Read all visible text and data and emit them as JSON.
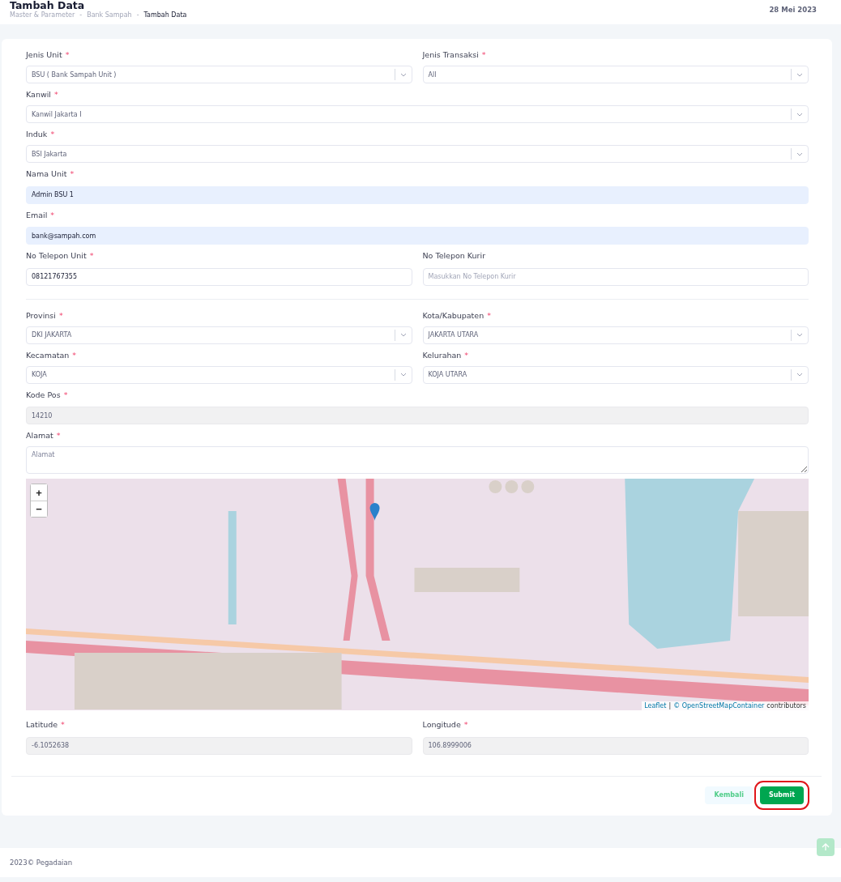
{
  "header": {
    "title": "Tambah Data",
    "breadcrumb": [
      {
        "label": "Master & Parameter",
        "current": false
      },
      {
        "label": "Bank Sampah",
        "current": false
      },
      {
        "label": "Tambah Data",
        "current": true
      }
    ],
    "separator": "-",
    "date": "28 Mei 2023"
  },
  "rows": [
    {
      "fields": [
        {
          "kind": "select",
          "label": "Jenis Unit",
          "required_mark": "*",
          "value": "BSU ( Bank Sampah Unit )"
        },
        {
          "kind": "select",
          "label": "Jenis Transaksi",
          "required_mark": "*",
          "value": "All"
        }
      ]
    },
    {
      "fields": [
        {
          "kind": "select",
          "label": "Kanwil",
          "required_mark": "*",
          "value": "Kanwil Jakarta I"
        }
      ]
    },
    {
      "fields": [
        {
          "kind": "select",
          "label": "Induk",
          "required_mark": "*",
          "value": "BSI Jakarta"
        }
      ]
    },
    {
      "fields": [
        {
          "kind": "text",
          "label": "Nama Unit",
          "required_mark": "*",
          "value": "Admin BSU 1",
          "autofilled": true,
          "disabled": false
        }
      ]
    },
    {
      "fields": [
        {
          "kind": "text",
          "label": "Email",
          "required_mark": "*",
          "value": "bank@sampah.com",
          "autofilled": true,
          "disabled": false
        }
      ]
    },
    {
      "fields": [
        {
          "kind": "text",
          "label": "No Telepon Unit",
          "required_mark": "*",
          "value": "08121767355",
          "autofilled": false,
          "disabled": false
        },
        {
          "kind": "text",
          "label": "No Telepon Kurir",
          "placeholder": "Masukkan No Telepon Kurir",
          "autofilled": false,
          "disabled": false
        }
      ]
    },
    {
      "divider": true,
      "fields": [
        {
          "kind": "select",
          "label": "Provinsi",
          "required_mark": "*",
          "value": "DKI JAKARTA"
        },
        {
          "kind": "select",
          "label": "Kota/Kabupaten",
          "required_mark": "*",
          "value": "JAKARTA UTARA"
        }
      ]
    },
    {
      "fields": [
        {
          "kind": "select",
          "label": "Kecamatan",
          "required_mark": "*",
          "value": "KOJA"
        },
        {
          "kind": "select",
          "label": "Kelurahan",
          "required_mark": "*",
          "value": "KOJA UTARA"
        }
      ]
    },
    {
      "fields": [
        {
          "kind": "text",
          "label": "Kode Pos",
          "required_mark": "*",
          "value": "14210",
          "disabled": true
        }
      ]
    },
    {
      "fields": [
        {
          "kind": "textarea",
          "label": "Alamat",
          "required_mark": "*",
          "placeholder": "Alamat"
        }
      ]
    },
    {
      "kind": "map",
      "zoom_in": "+",
      "zoom_out": "−",
      "attribution": {
        "leaflet": "Leaflet",
        "separator": "|",
        "source": "© OpenStreetMapContainer",
        "suffix": "contributors"
      }
    },
    {
      "fields": [
        {
          "kind": "text",
          "label": "Latitude",
          "required_mark": "*",
          "value": "-6.1052638",
          "disabled": true
        },
        {
          "kind": "text",
          "label": "Longitude",
          "required_mark": "*",
          "value": "106.8999006",
          "disabled": true
        }
      ]
    }
  ],
  "actions": [
    {
      "label": "Kembali",
      "kind": "secondary",
      "highlighted": false
    },
    {
      "label": "Submit",
      "kind": "primary",
      "highlighted": true
    }
  ],
  "footer": "2023© Pegadaian"
}
